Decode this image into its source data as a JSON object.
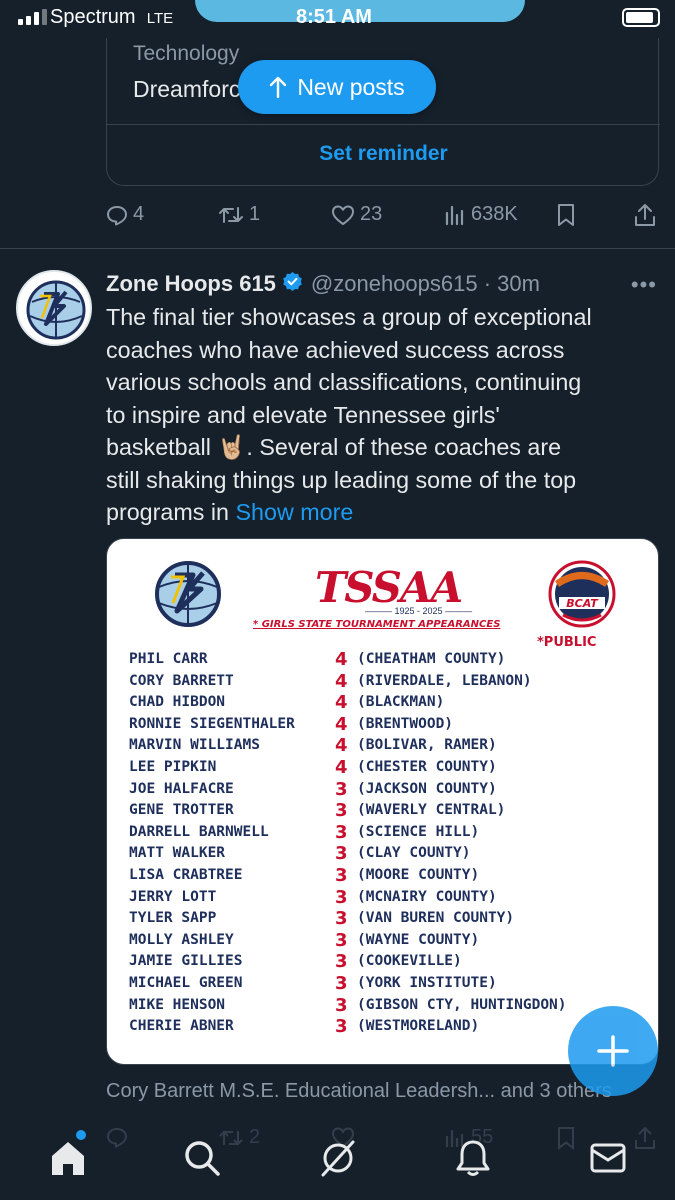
{
  "status_bar": {
    "carrier": "Spectrum",
    "network": "LTE",
    "time": "8:51 AM"
  },
  "space_card": {
    "category": "Technology",
    "title": "Dreamforce 2025",
    "reminder_label": "Set reminder"
  },
  "new_posts_label": "New posts",
  "prev_post_actions": {
    "replies": "4",
    "reposts": "1",
    "likes": "23",
    "views": "638K"
  },
  "post": {
    "display_name": "Zone Hoops 615",
    "handle": "@zonehoops615",
    "time": "30m",
    "text_lines": [
      "The final tier showcases a group of exceptional",
      "coaches who have achieved success across",
      "various schools and classifications, continuing",
      "to inspire and elevate Tennessee girls'",
      "basketball 🤘🏼. Several of these coaches are",
      "still shaking things up leading some of the top",
      "programs in"
    ],
    "show_more": "Show more",
    "liked_by": "Cory Barrett M.S.E. Educational Leadersh... and 3 others",
    "actions": {
      "reposts": "2",
      "views": "55"
    }
  },
  "graphic": {
    "logo_left": "ZH",
    "tssaa": "TSSAA",
    "years": "1925 - 2025",
    "subtitle": "* GIRLS STATE TOURNAMENT APPEARANCES",
    "logo_right": "BCAT",
    "note": "*PUBLIC",
    "coaches": [
      {
        "name": "PHIL CARR",
        "count": "4",
        "schools": "(CHEATHAM COUNTY)"
      },
      {
        "name": "CORY BARRETT",
        "count": "4",
        "schools": "(RIVERDALE, LEBANON)"
      },
      {
        "name": "CHAD HIBDON",
        "count": "4",
        "schools": "(BLACKMAN)"
      },
      {
        "name": "RONNIE SIEGENTHALER",
        "count": "4",
        "schools": "(BRENTWOOD)"
      },
      {
        "name": "MARVIN WILLIAMS",
        "count": "4",
        "schools": "(BOLIVAR, RAMER)"
      },
      {
        "name": "LEE PIPKIN",
        "count": "4",
        "schools": "(CHESTER COUNTY)"
      },
      {
        "name": "JOE HALFACRE",
        "count": "3",
        "schools": "(JACKSON COUNTY)"
      },
      {
        "name": "GENE TROTTER",
        "count": "3",
        "schools": "(WAVERLY CENTRAL)"
      },
      {
        "name": "DARRELL BARNWELL",
        "count": "3",
        "schools": "(SCIENCE HILL)"
      },
      {
        "name": "MATT WALKER",
        "count": "3",
        "schools": "(CLAY COUNTY)"
      },
      {
        "name": "LISA CRABTREE",
        "count": "3",
        "schools": "(MOORE COUNTY)"
      },
      {
        "name": "JERRY LOTT",
        "count": "3",
        "schools": "(MCNAIRY COUNTY)"
      },
      {
        "name": "TYLER SAPP",
        "count": "3",
        "schools": "(VAN BUREN COUNTY)"
      },
      {
        "name": "MOLLY ASHLEY",
        "count": "3",
        "schools": "(WAYNE COUNTY)"
      },
      {
        "name": "JAMIE GILLIES",
        "count": "3",
        "schools": "(COOKEVILLE)"
      },
      {
        "name": "MICHAEL GREEN",
        "count": "3",
        "schools": "(YORK INSTITUTE)"
      },
      {
        "name": "MIKE HENSON",
        "count": "3",
        "schools": "(GIBSON CTY, HUNTINGDON)"
      },
      {
        "name": "CHERIE ABNER",
        "count": "3",
        "schools": "(WESTMORELAND)"
      }
    ]
  },
  "bottom_nav": [
    "home-icon",
    "search-icon",
    "grok-icon",
    "notifications-icon",
    "messages-icon"
  ],
  "colors": {
    "background": "#15202b",
    "accent": "#1d9bf0",
    "muted": "#8b98a5",
    "text": "#e7e9ea",
    "navy": "#1f2f5c",
    "red": "#c8102e"
  }
}
